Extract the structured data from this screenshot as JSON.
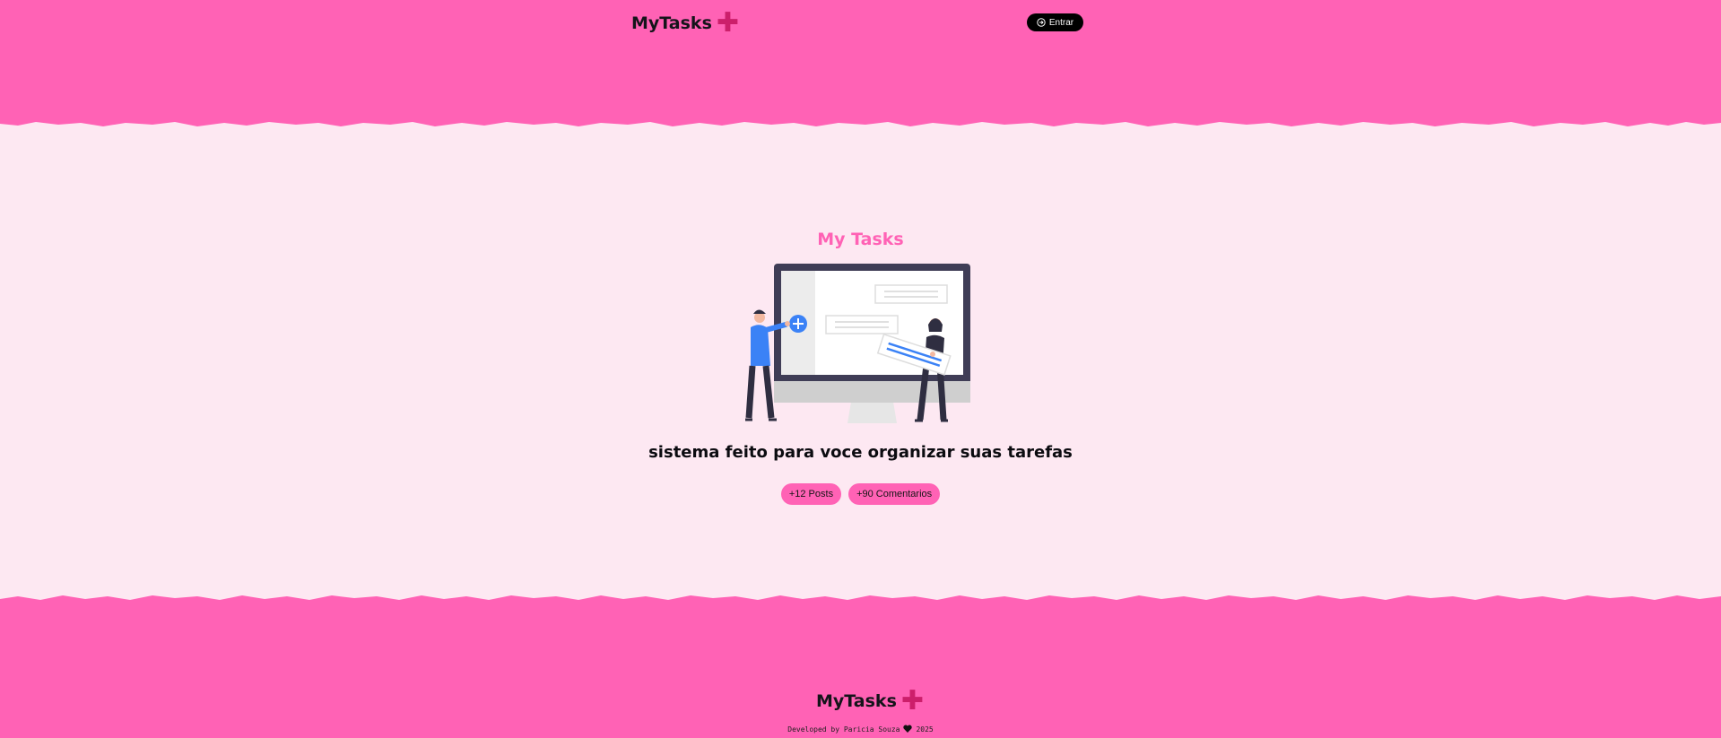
{
  "header": {
    "brand": "MyTasks",
    "brand_icon": "plus-icon",
    "login_label": "Entrar",
    "login_icon": "login-circle-icon"
  },
  "hero": {
    "title": "My Tasks",
    "tagline": "sistema feito para voce organizar suas tarefas",
    "badges": [
      "+12 Posts",
      "+90 Comentarios"
    ]
  },
  "footer": {
    "brand": "MyTasks",
    "credit_prefix": "Developed by Paricia Souza",
    "credit_year": "2025",
    "heart_icon": "heart-icon"
  },
  "colors": {
    "primary_pink": "#ff62b5",
    "background": "#fde8f2",
    "accent_plus": "#cc1f6b",
    "button_dark": "#000000"
  }
}
